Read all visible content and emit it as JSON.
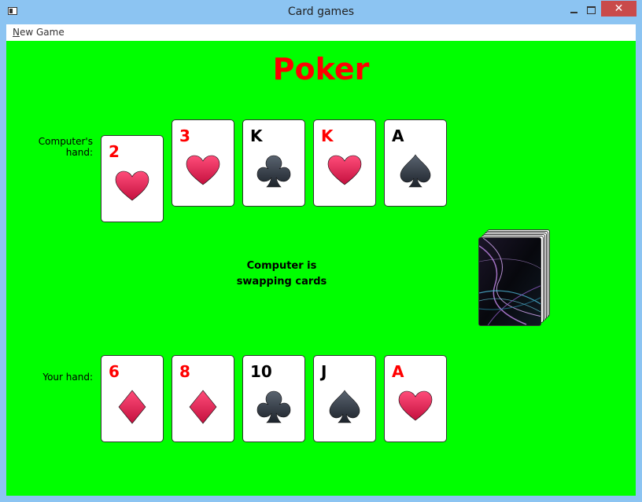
{
  "window": {
    "title": "Card games",
    "close_glyph": "✕"
  },
  "menu": {
    "new_game_mnemonic": "N",
    "new_game_rest": "ew Game"
  },
  "game": {
    "title": "Poker",
    "status": "Computer is swapping cards",
    "computer_label": "Computer's hand:",
    "player_label": "Your hand:",
    "computer_hand": [
      {
        "rank": "2",
        "suit": "heart",
        "raised": true
      },
      {
        "rank": "3",
        "suit": "heart",
        "raised": false
      },
      {
        "rank": "K",
        "suit": "club",
        "raised": false
      },
      {
        "rank": "K",
        "suit": "heart",
        "raised": false
      },
      {
        "rank": "A",
        "suit": "spade",
        "raised": false
      }
    ],
    "player_hand": [
      {
        "rank": "6",
        "suit": "diamond"
      },
      {
        "rank": "8",
        "suit": "diamond"
      },
      {
        "rank": "10",
        "suit": "club"
      },
      {
        "rank": "J",
        "suit": "spade"
      },
      {
        "rank": "A",
        "suit": "heart"
      }
    ]
  },
  "colors": {
    "table": "#00ff00",
    "title": "#ff0000",
    "red_suit": "#ff0000",
    "black_suit": "#000000"
  }
}
